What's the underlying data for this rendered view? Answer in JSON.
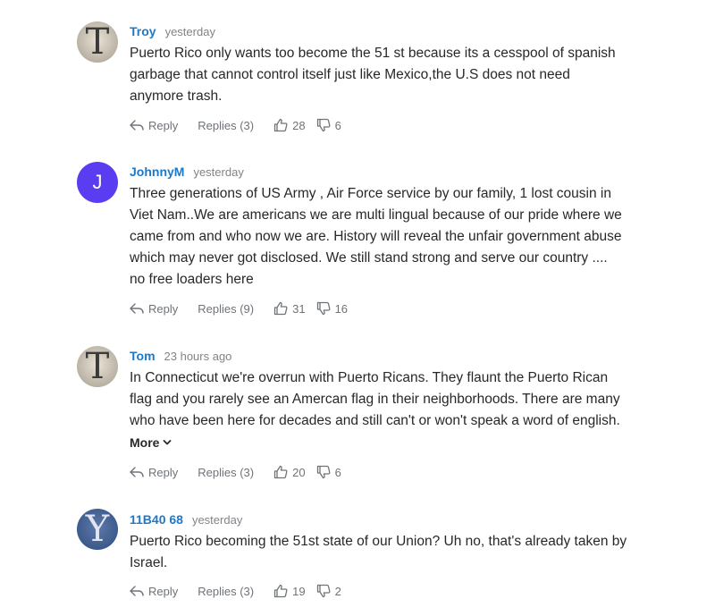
{
  "colors": {
    "author": "#1d79c8",
    "text": "#26282a",
    "meta": "#808488",
    "action": "#6e7378",
    "avatar_letter_bg": "#5a3df0"
  },
  "labels": {
    "reply": "Reply",
    "more": "More"
  },
  "comments": [
    {
      "author": "Troy",
      "time": "yesterday",
      "avatar": {
        "type": "serif-initial",
        "text": "T"
      },
      "lines": [
        "Puerto Rico only wants too become the 51 st because its a cesspool of spanish",
        "garbage that cannot control itself just like Mexico,the U.S does not need",
        "anymore trash."
      ],
      "replies": "Replies (3)",
      "upvotes": "28",
      "downvotes": "6"
    },
    {
      "author": "JohnnyM",
      "time": "yesterday",
      "avatar": {
        "type": "letter",
        "text": "J"
      },
      "lines": [
        "Three generations of US Army , Air Force service by our family, 1 lost cousin in",
        "Viet Nam..We are americans we are multi lingual because of our pride where we",
        "came from and who now we are. History will reveal the unfair government abuse",
        "which may never got disclosed. We still stand strong and serve our country ....",
        "no free loaders here"
      ],
      "replies": "Replies (9)",
      "upvotes": "31",
      "downvotes": "16"
    },
    {
      "author": "Tom",
      "time": "23 hours ago",
      "avatar": {
        "type": "serif-initial",
        "text": "T"
      },
      "lines": [
        "In Connecticut we're overrun with Puerto Ricans. They flaunt the Puerto Rican",
        "flag and you rarely see an Amercan flag in their neighborhoods. There are many",
        "who have been here for decades and still can't or won't speak a word of english."
      ],
      "replies": "Replies (3)",
      "upvotes": "20",
      "downvotes": "6"
    },
    {
      "author": "11B40 68",
      "time": "yesterday",
      "avatar": {
        "type": "serif-initial-blue",
        "text": "Y"
      },
      "lines": [
        "Puerto Rico becoming the 51st state of our Union? Uh no, that's already taken by",
        "Israel."
      ],
      "replies": "Replies (3)",
      "upvotes": "19",
      "downvotes": "2"
    }
  ]
}
